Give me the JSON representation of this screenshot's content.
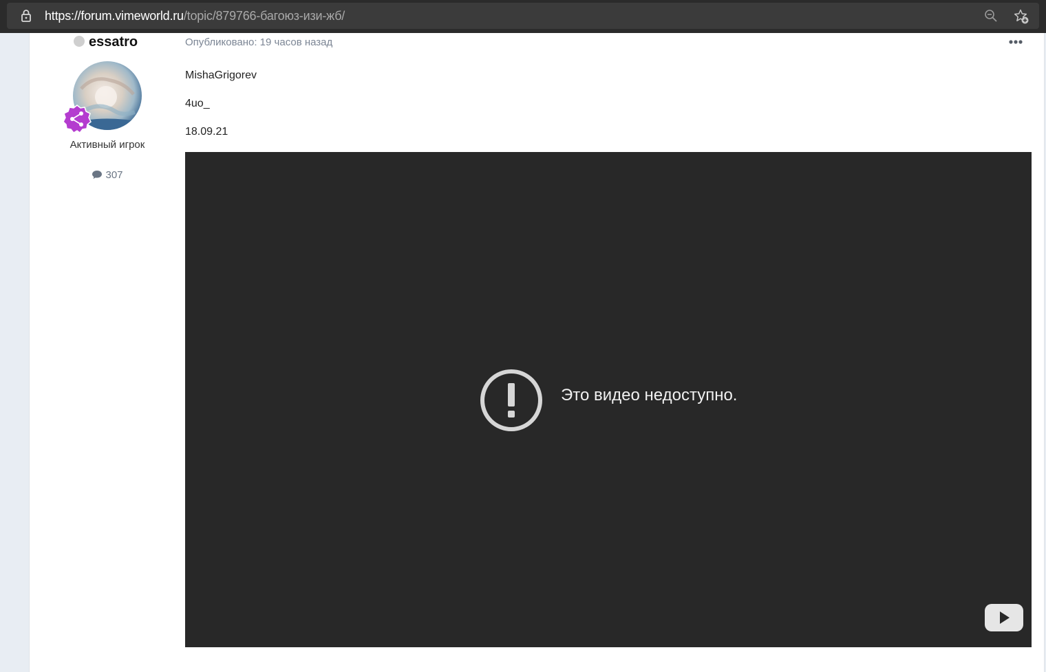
{
  "browser": {
    "url_host": "https://forum.vimeworld.ru",
    "url_path": "/topic/879766-багоюз-изи-жб/"
  },
  "author": {
    "name": "essatro",
    "title": "Активный игрок",
    "post_count": "307",
    "online": false
  },
  "post": {
    "date": "Опубликовано: 19 часов назад",
    "lines": [
      "MishaGrigorev",
      "4uo_",
      "18.09.21"
    ]
  },
  "video": {
    "error_message": "Это видео недоступно."
  },
  "icons": {
    "lock": "lock-icon",
    "zoom": "zoom-out-icon",
    "favorite": "star-add-icon",
    "more": "ellipsis-icon",
    "comment": "comment-icon",
    "error": "exclamation-circle-icon",
    "youtube": "youtube-icon",
    "rank": "share-badge-icon"
  },
  "colors": {
    "rank_badge": "#b43ccf",
    "video_bg": "#282828",
    "meta_text": "#7b8594"
  }
}
